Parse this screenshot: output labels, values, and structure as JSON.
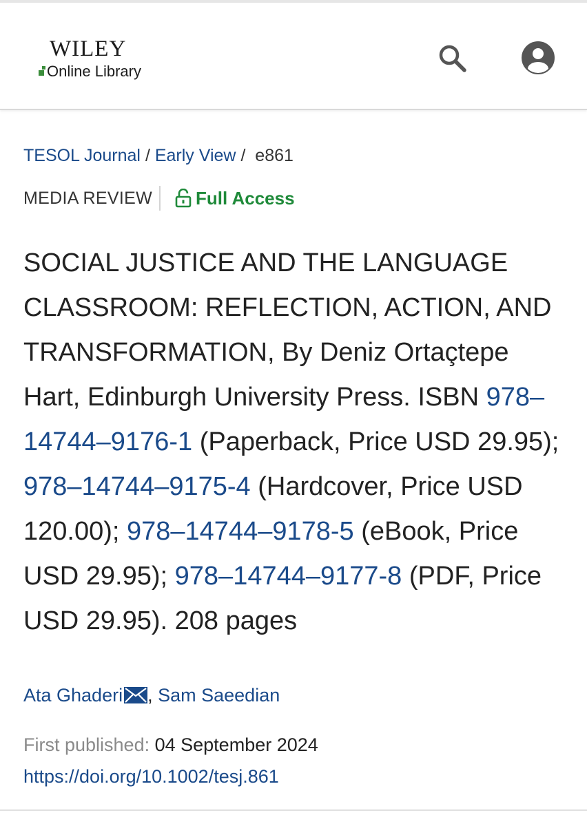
{
  "brand": {
    "name": "WILEY",
    "subname": "Online Library",
    "logo_green": "#3b8d3b"
  },
  "header": {
    "icons": [
      "search-icon",
      "account-icon"
    ]
  },
  "breadcrumb": {
    "journal": "TESOL Journal",
    "section": "Early View",
    "separator": "/",
    "article_id": "e861"
  },
  "meta": {
    "article_type": "MEDIA REVIEW",
    "access_label": "Full Access",
    "access_color": "#1f8a3a"
  },
  "title": {
    "part1": "SOCIAL JUSTICE AND THE LANGUAGE CLASSROOM: REFLECTION, ACTION, AND TRANSFORMATION, By Deniz Ortaçtepe Hart, Edinburgh University Press. ISBN ",
    "isbn1": "978–14744–9176-1",
    "part2": " (Paperback, Price USD 29.95); ",
    "isbn2": "978–14744–9175-4",
    "part3": " (Hardcover, Price USD 120.00); ",
    "isbn3": "978–14744–9178-5",
    "part4": " (eBook, Price USD 29.95); ",
    "isbn4": "978–14744–9177-8",
    "part5": " (PDF, Price USD 29.95). 208 pages"
  },
  "authors": {
    "author1": "Ata Ghaderi",
    "separator": ", ",
    "author2": "Sam Saeedian"
  },
  "publication": {
    "first_published_label": "First published:",
    "date": "04 September 2024",
    "doi": "https://doi.org/10.1002/tesj.861"
  },
  "colors": {
    "link": "#1a4a8a",
    "text": "#222222",
    "muted": "#8a8a8a"
  }
}
